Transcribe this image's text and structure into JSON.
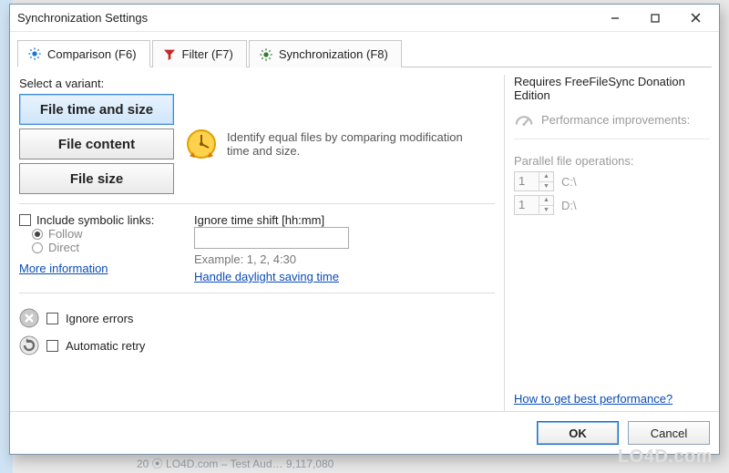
{
  "window": {
    "title": "Synchronization Settings"
  },
  "tabs": {
    "comparison": "Comparison (F6)",
    "filter": "Filter (F7)",
    "sync": "Synchronization (F8)"
  },
  "left": {
    "select_label": "Select a variant:",
    "variants": {
      "time_size": "File time and size",
      "content": "File content",
      "size": "File size"
    },
    "description": "Identify equal files by comparing modification time and size.",
    "symlinks": {
      "header": "Include symbolic links:",
      "follow": "Follow",
      "direct": "Direct",
      "more_info": "More information"
    },
    "timeshift": {
      "label": "Ignore time shift [hh:mm]",
      "value": "",
      "example": "Example: 1, 2, 4:30",
      "dst_link": "Handle daylight saving time"
    },
    "ignore_errors": "Ignore errors",
    "auto_retry": "Automatic retry"
  },
  "right": {
    "title": "Requires FreeFileSync Donation Edition",
    "perf": "Performance improvements:",
    "pfo_label": "Parallel file operations:",
    "rows": [
      {
        "value": "1",
        "path": "C:\\"
      },
      {
        "value": "1",
        "path": "D:\\"
      }
    ],
    "link": "How to get best performance?"
  },
  "footer": {
    "ok": "OK",
    "cancel": "Cancel"
  },
  "watermark": "LO4D.com",
  "bgline": "20  ⦿  LO4D.com – Test Aud…          9,117,080"
}
